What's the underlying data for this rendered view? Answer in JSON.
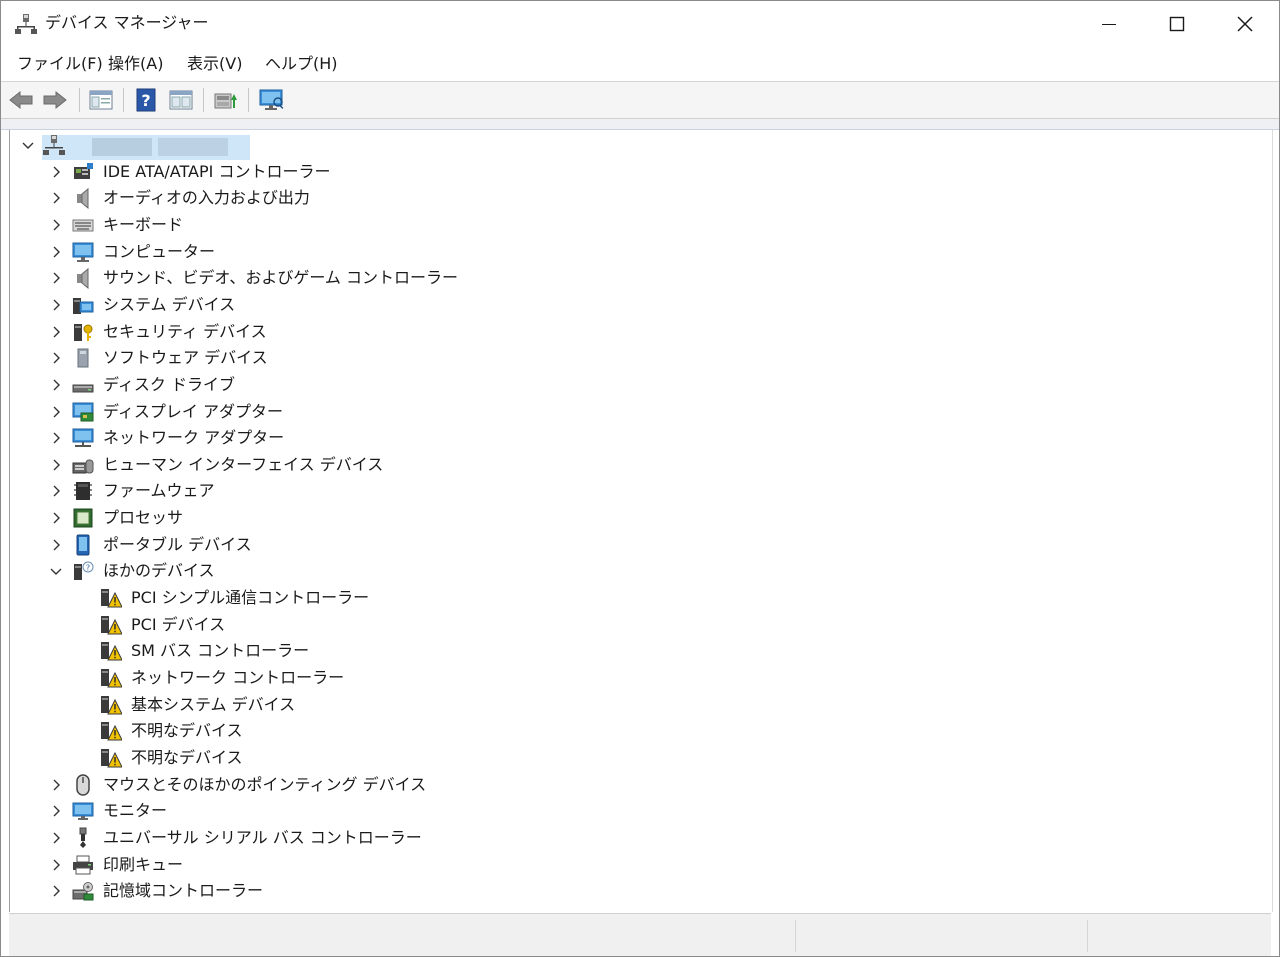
{
  "window": {
    "title": "デバイス マネージャー"
  },
  "menu": [
    "ファイル(F)",
    "操作(A)",
    "表示(V)",
    "ヘルプ(H)"
  ],
  "toolbar": [
    "back-arrow-icon",
    "forward-arrow-icon",
    "properties-pane-icon",
    "help-icon",
    "view-pane-icon",
    "update-driver-icon",
    "scan-hardware-icon"
  ],
  "tree": {
    "root_label": "",
    "categories": [
      {
        "label": "IDE ATA/ATAPI コントローラー",
        "icon": "ide-controller-icon",
        "expanded": false
      },
      {
        "label": "オーディオの入力および出力",
        "icon": "speaker-icon",
        "expanded": false
      },
      {
        "label": "キーボード",
        "icon": "keyboard-icon",
        "expanded": false
      },
      {
        "label": "コンピューター",
        "icon": "computer-icon",
        "expanded": false
      },
      {
        "label": "サウンド、ビデオ、およびゲーム コントローラー",
        "icon": "speaker-icon",
        "expanded": false
      },
      {
        "label": "システム デバイス",
        "icon": "system-device-icon",
        "expanded": false
      },
      {
        "label": "セキュリティ デバイス",
        "icon": "security-key-icon",
        "expanded": false
      },
      {
        "label": "ソフトウェア デバイス",
        "icon": "software-device-icon",
        "expanded": false
      },
      {
        "label": "ディスク ドライブ",
        "icon": "disk-drive-icon",
        "expanded": false
      },
      {
        "label": "ディスプレイ アダプター",
        "icon": "display-adapter-icon",
        "expanded": false
      },
      {
        "label": "ネットワーク アダプター",
        "icon": "network-adapter-icon",
        "expanded": false
      },
      {
        "label": "ヒューマン インターフェイス デバイス",
        "icon": "hid-icon",
        "expanded": false
      },
      {
        "label": "ファームウェア",
        "icon": "firmware-icon",
        "expanded": false
      },
      {
        "label": "プロセッサ",
        "icon": "processor-icon",
        "expanded": false
      },
      {
        "label": "ポータブル デバイス",
        "icon": "portable-device-icon",
        "expanded": false
      },
      {
        "label": "ほかのデバイス",
        "icon": "other-devices-icon",
        "expanded": true,
        "children": [
          {
            "label": "PCI シンプル通信コントローラー",
            "icon": "warning-device-icon"
          },
          {
            "label": "PCI デバイス",
            "icon": "warning-device-icon"
          },
          {
            "label": "SM バス コントローラー",
            "icon": "warning-device-icon"
          },
          {
            "label": "ネットワーク コントローラー",
            "icon": "warning-device-icon"
          },
          {
            "label": "基本システム デバイス",
            "icon": "warning-device-icon"
          },
          {
            "label": "不明なデバイス",
            "icon": "warning-device-icon"
          },
          {
            "label": "不明なデバイス",
            "icon": "warning-device-icon"
          }
        ]
      },
      {
        "label": "マウスとそのほかのポインティング デバイス",
        "icon": "mouse-icon",
        "expanded": false
      },
      {
        "label": "モニター",
        "icon": "monitor-icon",
        "expanded": false
      },
      {
        "label": "ユニバーサル シリアル バス コントローラー",
        "icon": "usb-icon",
        "expanded": false
      },
      {
        "label": "印刷キュー",
        "icon": "printer-icon",
        "expanded": false
      },
      {
        "label": "記憶域コントローラー",
        "icon": "storage-controller-icon",
        "expanded": false
      }
    ]
  },
  "colors": {
    "accent": "#0a6ed1",
    "warning": "#f2c200",
    "selection": "#cfe6f8"
  }
}
